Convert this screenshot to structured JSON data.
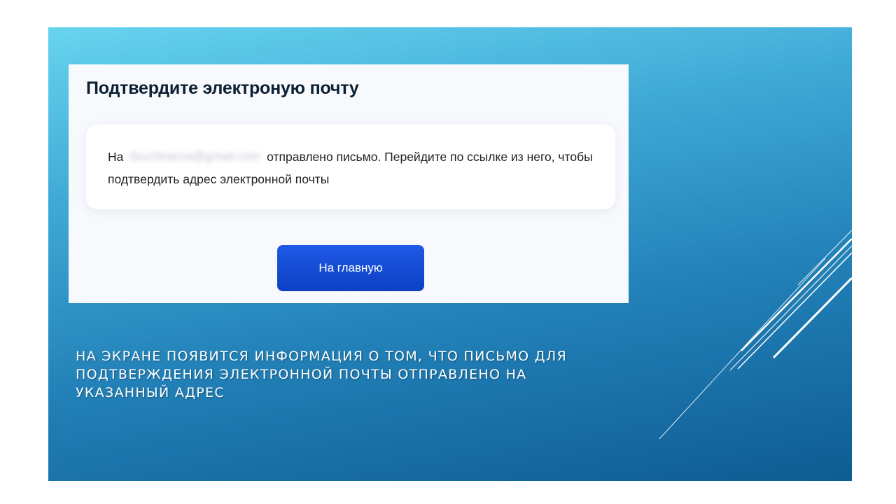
{
  "dialog": {
    "title": "Подтвердите электроную почту",
    "message_prefix": "На",
    "email_blurred": "tbuchkaeva@gmail.com",
    "message_suffix": "отправлено письмо. Перейдите по ссылке из него, чтобы подтвердить адрес электронной почты",
    "home_button_label": "На главную"
  },
  "slide": {
    "caption": "На экране появится информация о том, что письмо для подтверждения электронной почты отправлено на указанный адрес"
  },
  "colors": {
    "button_primary": "#0d4cd3",
    "heading_text": "#0b1f33",
    "slide_gradient_top": "#67d4ef",
    "slide_gradient_bottom": "#0e5c93"
  }
}
